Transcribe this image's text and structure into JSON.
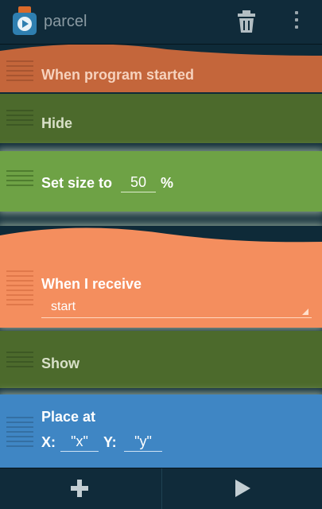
{
  "app": {
    "title": "parcel"
  },
  "colors": {
    "background": "#0e2a38",
    "event_brick": "#f48e5e",
    "looks_brick_dark": "#4c6a2c",
    "looks_brick": "#6ea245",
    "motion_brick": "#3f86c4"
  },
  "actionbar": {
    "icons": [
      "app-icon",
      "trash-icon",
      "overflow-menu-icon"
    ]
  },
  "bricks": {
    "when_started": {
      "label": "When program started"
    },
    "hide": {
      "label": "Hide"
    },
    "set_size": {
      "label": "Set size to",
      "value": "50",
      "unit": "%"
    },
    "when_receive": {
      "label": "When I receive",
      "message": "start"
    },
    "show": {
      "label": "Show"
    },
    "place_at": {
      "label": "Place at",
      "x_label": "X:",
      "x_value": "\"x\"",
      "y_label": "Y:",
      "y_value": "\"y\""
    }
  },
  "bottombar": {
    "icons": [
      "add-icon",
      "play-icon"
    ]
  }
}
